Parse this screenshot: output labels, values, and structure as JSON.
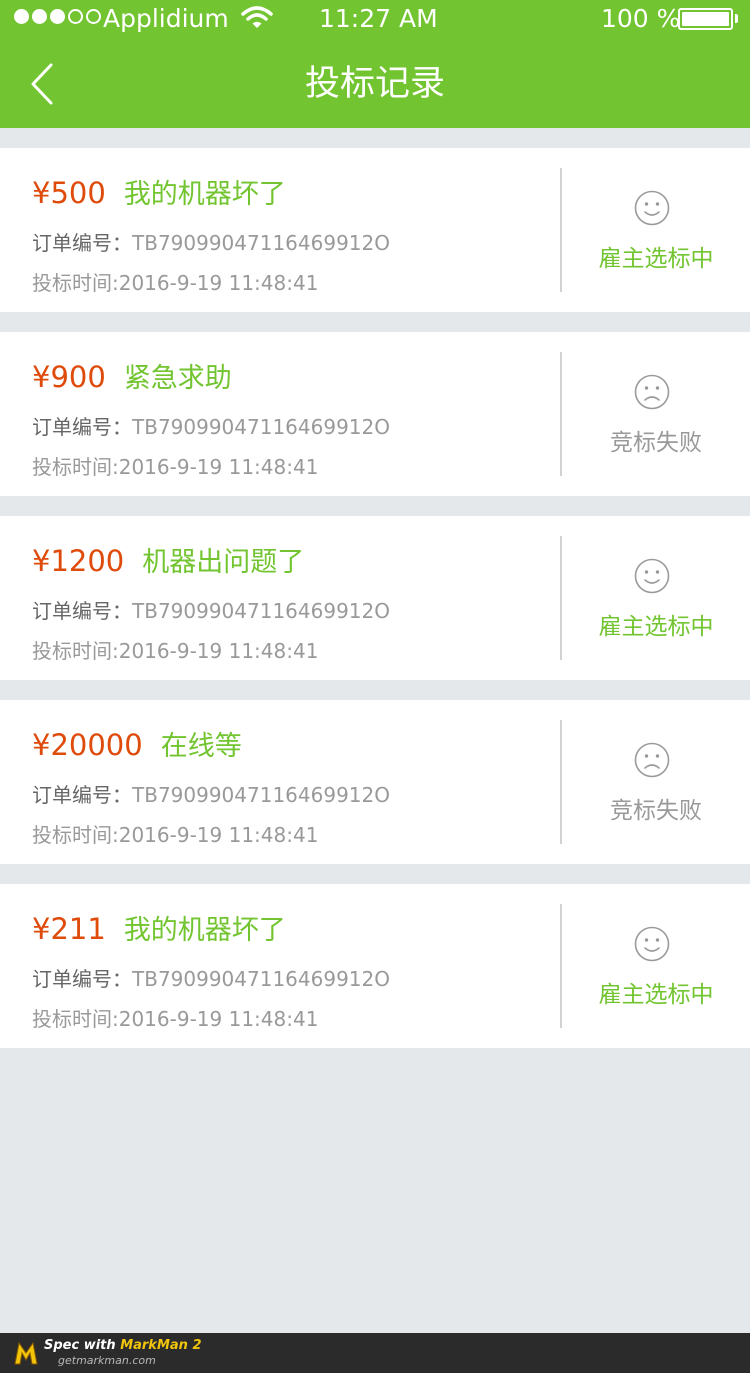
{
  "statusbar": {
    "carrier": "Applidium",
    "time": "11:27 AM",
    "battery": "100 %"
  },
  "header": {
    "title": "投标记录",
    "back_icon": "chevron-left-icon"
  },
  "colors": {
    "brand_green": "#72c530",
    "price_orange": "#de4b0a",
    "background": "#e5e8ea",
    "divider": "#d2d2d2",
    "label_gray": "#666666",
    "value_gray": "#999999"
  },
  "bids": [
    {
      "price": "¥500",
      "desc": "我的机器坏了",
      "order_label": "订单编号：",
      "order_no": "TB79099047116469912O",
      "time": "投标时间:2016-9-19 11:48:41",
      "status": "雇主选标中",
      "face_icon": "smile-face-icon"
    },
    {
      "price": "¥900",
      "desc": "紧急求助",
      "order_label": "订单编号：",
      "order_no": "TB79099047116469912O",
      "time": "投标时间:2016-9-19 11:48:41",
      "status": "竞标失败",
      "face_icon": "sad-face-icon"
    },
    {
      "price": "¥1200",
      "desc": "机器出问题了",
      "order_label": "订单编号：",
      "order_no": "TB79099047116469912O",
      "time": "投标时间:2016-9-19 11:48:41",
      "status": "雇主选标中",
      "face_icon": "smile-face-icon"
    },
    {
      "price": "¥20000",
      "desc": "在线等",
      "order_label": "订单编号：",
      "order_no": "TB79099047116469912O",
      "time": "投标时间:2016-9-19 11:48:41",
      "status": "竞标失败",
      "face_icon": "sad-face-icon"
    },
    {
      "price": "¥211",
      "desc": "我的机器坏了",
      "order_label": "订单编号：",
      "order_no": "TB79099047116469912O",
      "time": "投标时间:2016-9-19 11:48:41",
      "status": "雇主选标中",
      "face_icon": "smile-face-icon"
    }
  ],
  "footer": {
    "spec_with": "Spec with",
    "brand": "MarkMan 2",
    "site": "getmarkman.com"
  }
}
